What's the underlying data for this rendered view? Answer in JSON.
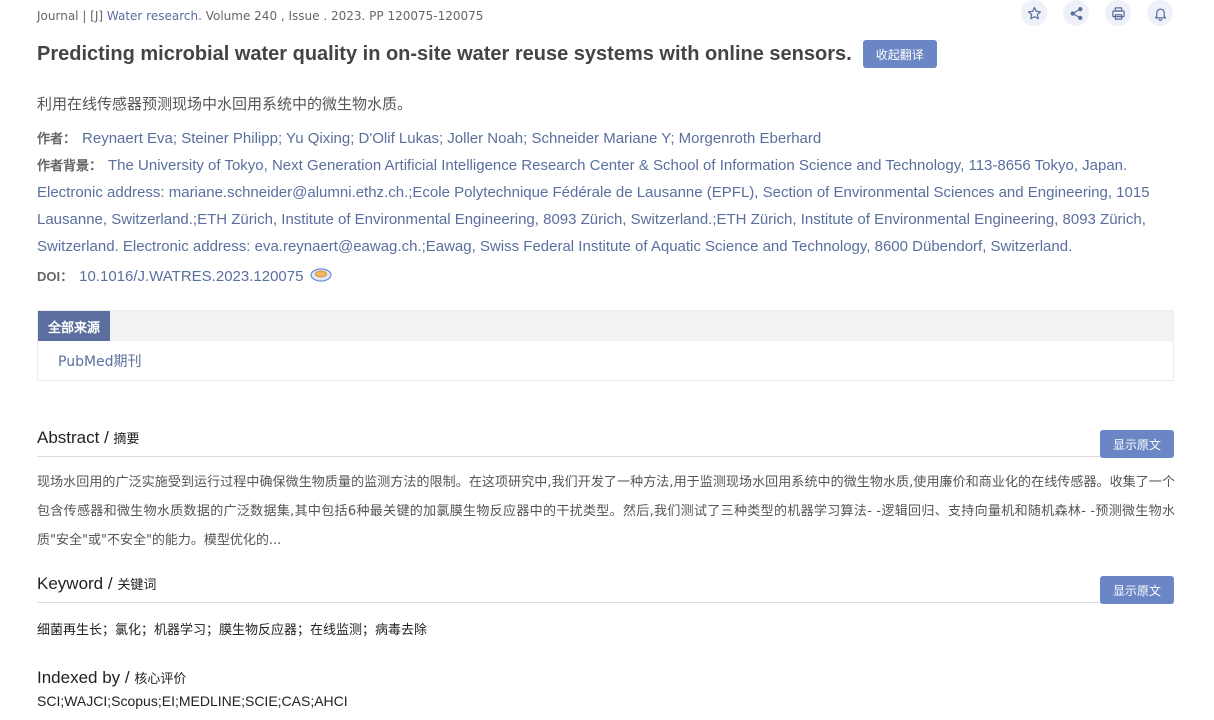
{
  "journal": {
    "prefix": "Journal | [J] ",
    "name": "Water research",
    "rest": ". Volume 240 , Issue . 2023. PP 120075-120075"
  },
  "toolbar": {
    "icons": [
      "star-icon",
      "share-icon",
      "print-icon",
      "bell-icon"
    ],
    "accent": "#6b86c4"
  },
  "article": {
    "title": "Predicting microbial water quality in on-site water reuse systems with online sensors.",
    "translate_button": "收起翻译",
    "title_cn": "利用在线传感器预测现场中水回用系统中的微生物水质。",
    "authors_label": "作者：",
    "authors": "Reynaert Eva; Steiner Philipp; Yu Qixing; D'Olif Lukas; Joller Noah; Schneider Mariane Y; Morgenroth Eberhard",
    "affiliation_label": "作者背景：",
    "affiliation": "The University of Tokyo, Next Generation Artificial Intelligence Research Center & School of Information Science and Technology, 113-8656 Tokyo, Japan. Electronic address: mariane.schneider@alumni.ethz.ch.;Ecole Polytechnique Fédérale de Lausanne (EPFL), Section of Environmental Sciences and Engineering, 1015 Lausanne, Switzerland.;ETH Zürich, Institute of Environmental Engineering, 8093 Zürich, Switzerland.;ETH Zürich, Institute of Environmental Engineering, 8093 Zürich, Switzerland. Electronic address: eva.reynaert@eawag.ch.;Eawag, Swiss Federal Institute of Aquatic Science and Technology, 8600 Dübendorf, Switzerland.",
    "doi_label": "DOI：",
    "doi": "10.1016/J.WATRES.2023.120075"
  },
  "sources": {
    "tab": "全部来源",
    "items": [
      "PubMed期刊"
    ]
  },
  "abstract": {
    "title_en": "Abstract / ",
    "title_cn": "摘要",
    "button": "显示原文",
    "text": "现场水回用的广泛实施受到运行过程中确保微生物质量的监测方法的限制。在这项研究中,我们开发了一种方法,用于监测现场水回用系统中的微生物水质,使用廉价和商业化的在线传感器。收集了一个包含传感器和微生物水质数据的广泛数据集,其中包括6种最关键的加氯膜生物反应器中的干扰类型。然后,我们测试了三种类型的机器学习算法- -逻辑回归、支持向量机和随机森林- -预测微生物水质\"安全\"或\"不安全\"的能力。模型优化的..."
  },
  "keyword": {
    "title_en": "Keyword / ",
    "title_cn": "关键词",
    "button": "显示原文",
    "text": "细菌再生长；氯化；机器学习；膜生物反应器；在线监测；病毒去除"
  },
  "indexed": {
    "title_en": "Indexed by / ",
    "title_cn": "核心评价",
    "text": "SCI;WAJCI;Scopus;EI;MEDLINE;SCIE;CAS;AHCI"
  }
}
